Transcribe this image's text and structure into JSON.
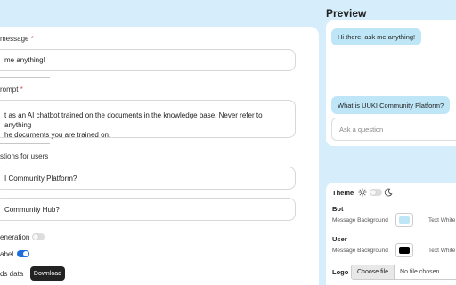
{
  "config": {
    "welcome_label": "message",
    "required_mark": "*",
    "welcome_value": "me anything!",
    "prompt_label": "rompt",
    "prompt_value_line1": "t as an AI chatbot trained on the documents in the knowledge base. Never refer to anything",
    "prompt_value_line2": "he documents you are trained on.",
    "suggestions_label": "stions for users",
    "suggestion_1": "I Community Platform?",
    "suggestion_2": "Community Hub?",
    "generation_label": "eneration",
    "generation_on": false,
    "label_label": "abel",
    "label_on": true,
    "downloads_label": "ds data",
    "download_button": "Download"
  },
  "preview": {
    "title": "Preview",
    "bot_greeting": "Hi there, ask me anything!",
    "user_message": "What is UUKI Community Platform?",
    "ask_placeholder": "Ask a question"
  },
  "theme": {
    "theme_label": "Theme",
    "dark_mode": false,
    "bot_label": "Bot",
    "bot_msg_bg_label": "Message Background",
    "bot_msg_bg_color": "#bfe6f7",
    "bot_text_label": "Text White",
    "user_label": "User",
    "user_msg_bg_label": "Message Background",
    "user_msg_bg_color": "#000000",
    "user_text_label": "Text White",
    "logo_label": "Logo",
    "choose_file": "Choose file",
    "no_file": "No file chosen"
  }
}
